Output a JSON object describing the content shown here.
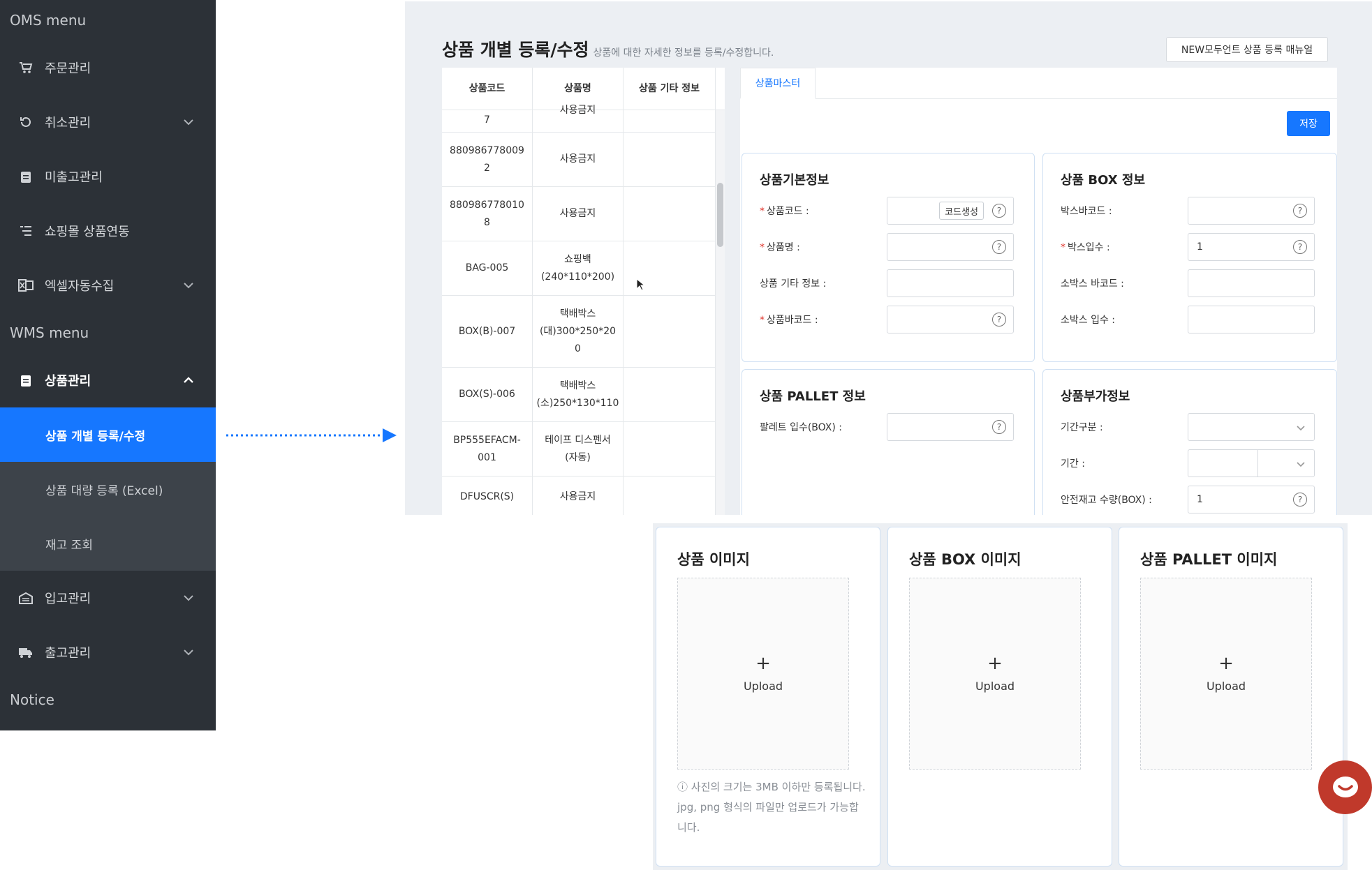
{
  "sidebar": {
    "oms_title": "OMS menu",
    "oms_items": [
      {
        "label": "주문관리",
        "icon": "cart-icon"
      },
      {
        "label": "취소관리",
        "icon": "undo-icon"
      },
      {
        "label": "미출고관리",
        "icon": "clipboard-icon"
      },
      {
        "label": "쇼핑몰 상품연동",
        "icon": "sync-list-icon"
      },
      {
        "label": "엑셀자동수집",
        "icon": "excel-icon"
      }
    ],
    "wms_title": "WMS menu",
    "product_menu": {
      "label": "상품관리",
      "icon": "clipboard-icon"
    },
    "product_sub": [
      "상품 개별 등록/수정",
      "상품 대량 등록 (Excel)",
      "재고 조회"
    ],
    "inbound": {
      "label": "입고관리",
      "icon": "warehouse-icon"
    },
    "outbound": {
      "label": "출고관리",
      "icon": "truck-icon"
    },
    "notice_title": "Notice"
  },
  "page": {
    "title": "상품 개별 등록/수정",
    "subtitle": "상품에 대한 자세한 정보를 등록/수정합니다.",
    "manual_button": "NEW모두언트 상품 등록 매뉴얼"
  },
  "list": {
    "headers": [
      "상품코드",
      "상품명",
      "상품 기타 정보"
    ],
    "rows": [
      {
        "code": "7",
        "name": "사용금지",
        "etc": ""
      },
      {
        "code": "880986778009\n2",
        "name": "사용금지",
        "etc": ""
      },
      {
        "code": "880986778010\n8",
        "name": "사용금지",
        "etc": ""
      },
      {
        "code": "BAG-005",
        "name": "쇼핑백\n(240*110*200)",
        "etc": ""
      },
      {
        "code": "BOX(B)-007",
        "name": "택배박스\n(대)300*250*20\n0",
        "etc": ""
      },
      {
        "code": "BOX(S)-006",
        "name": "택배박스\n(소)250*130*110",
        "etc": ""
      },
      {
        "code": "BP555EFACM-\n001",
        "name": "테이프 디스펜서\n(자동)",
        "etc": ""
      },
      {
        "code": "DFUSCR(S)",
        "name": "사용금지",
        "etc": ""
      }
    ]
  },
  "form": {
    "tab_label": "상품마스터",
    "save_label": "저장",
    "basic": {
      "title": "상품기본정보",
      "code_label": "상품코드 :",
      "codegen_label": "코드생성",
      "name_label": "상품명 :",
      "etc_label": "상품 기타 정보 :",
      "barcode_label": "상품바코드 :"
    },
    "box": {
      "title": "상품 BOX 정보",
      "box_barcode_label": "박스바코드 :",
      "box_qty_label": "박스입수 :",
      "box_qty_value": "1",
      "small_barcode_label": "소박스 바코드 :",
      "small_qty_label": "소박스 입수 :"
    },
    "pallet": {
      "title": "상품 PALLET 정보",
      "pallet_qty_label": "팔레트 입수(BOX) :"
    },
    "extra": {
      "title": "상품부가정보",
      "period_type_label": "기간구분 :",
      "period_label": "기간 :",
      "safety_label": "안전재고 수량(BOX) :",
      "safety_value": "1"
    },
    "help_glyph": "?"
  },
  "images": {
    "cards": [
      {
        "title": "상품 이미지",
        "upload": "Upload"
      },
      {
        "title": "상품 BOX 이미지",
        "upload": "Upload"
      },
      {
        "title": "상품 PALLET 이미지",
        "upload": "Upload"
      }
    ],
    "plus_glyph": "+",
    "note": "ⓘ 사진의 크기는 3MB 이하만 등록됩니다. jpg, png 형식의 파일만 업로드가 가능합니다."
  },
  "colors": {
    "sidebar_bg": "#2c3137",
    "accent": "#1677ff",
    "chat": "#c0392b"
  }
}
